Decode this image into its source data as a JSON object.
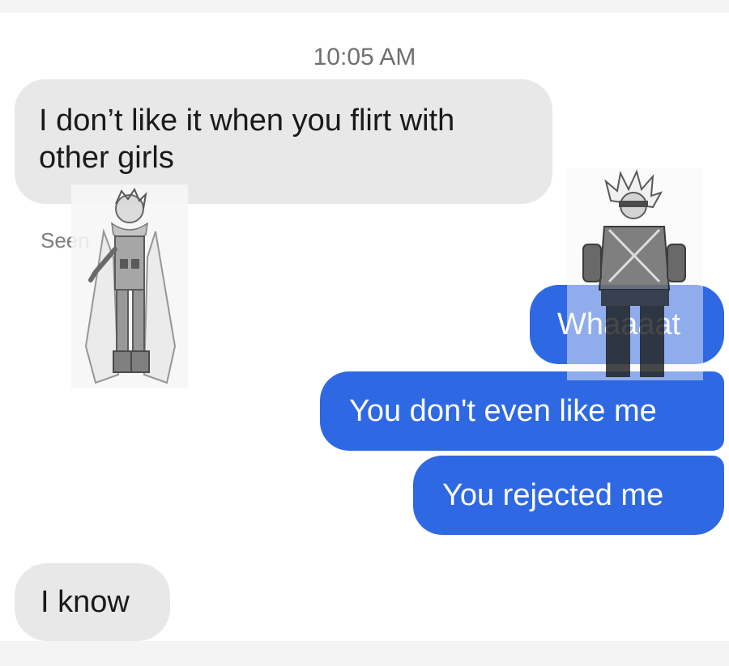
{
  "conversation": {
    "timestamp": "10:05 AM",
    "messages": [
      {
        "side": "incoming",
        "text": "I don’t like it when you flirt with other girls"
      },
      {
        "side": "outgoing",
        "text": "Whaaaat"
      },
      {
        "side": "outgoing",
        "text": "You don't even like me"
      },
      {
        "side": "outgoing",
        "text": "You rejected me"
      },
      {
        "side": "incoming",
        "text": "I know"
      }
    ],
    "read_receipt": "Seen"
  },
  "colors": {
    "incoming_bubble": "#e8e8e8",
    "outgoing_bubble": "#2f68e3",
    "background": "#ffffff"
  },
  "stickers": [
    {
      "name": "caped-hero-sticker"
    },
    {
      "name": "armored-hero-sticker"
    }
  ]
}
